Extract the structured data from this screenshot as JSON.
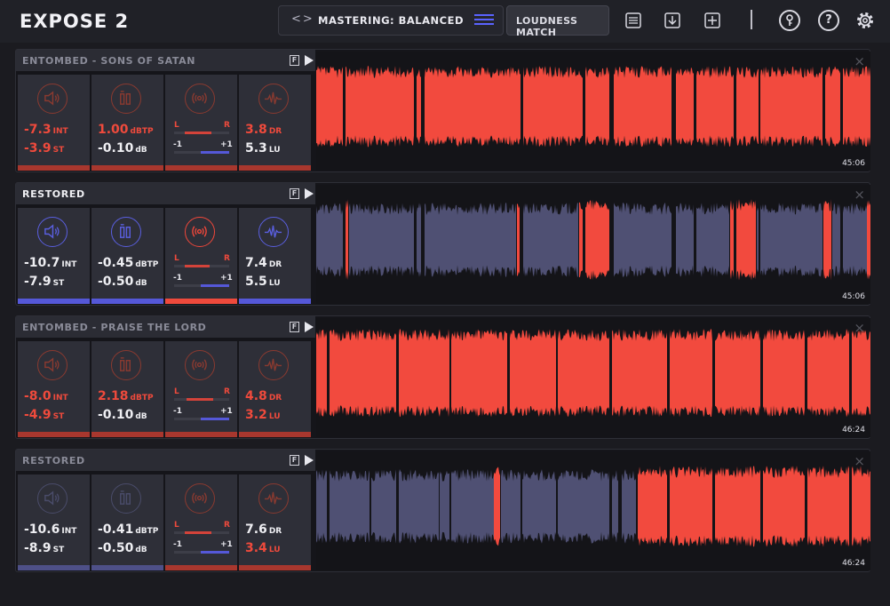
{
  "header": {
    "title": "EXPOSE 2",
    "preset_arrows": "<>",
    "preset_label": "MASTERING: BALANCED",
    "loudness_match_label": "LOUDNESS MATCH"
  },
  "rows": [
    {
      "title": "ENTOMBED - SONS OF SATAN",
      "active": false,
      "f_label": "F",
      "loudness": {
        "int": "-7.3",
        "int_unit": "INT",
        "st": "-3.9",
        "st_unit": "ST"
      },
      "peak": {
        "tp": "1.00",
        "tp_unit": "dBTP",
        "db": "-0.10",
        "db_unit": "dB"
      },
      "correlation": {
        "left": "L",
        "right": "R",
        "min": "-1",
        "max": "+1"
      },
      "dynamics": {
        "dr": "3.8",
        "dr_unit": "DR",
        "lu": "5.3",
        "lu_unit": "LU"
      },
      "duration": "45:06",
      "close": "×"
    },
    {
      "title": "RESTORED",
      "active": true,
      "f_label": "F",
      "loudness": {
        "int": "-10.7",
        "int_unit": "INT",
        "st": "-7.9",
        "st_unit": "ST"
      },
      "peak": {
        "tp": "-0.45",
        "tp_unit": "dBTP",
        "db": "-0.50",
        "db_unit": "dB"
      },
      "correlation": {
        "left": "L",
        "right": "R",
        "min": "-1",
        "max": "+1"
      },
      "dynamics": {
        "dr": "7.4",
        "dr_unit": "DR",
        "lu": "5.5",
        "lu_unit": "LU"
      },
      "duration": "45:06",
      "close": "×"
    },
    {
      "title": "ENTOMBED - PRAISE THE LORD",
      "active": false,
      "f_label": "F",
      "loudness": {
        "int": "-8.0",
        "int_unit": "INT",
        "st": "-4.9",
        "st_unit": "ST"
      },
      "peak": {
        "tp": "2.18",
        "tp_unit": "dBTP",
        "db": "-0.10",
        "db_unit": "dB"
      },
      "correlation": {
        "left": "L",
        "right": "R",
        "min": "-1",
        "max": "+1"
      },
      "dynamics": {
        "dr": "4.8",
        "dr_unit": "DR",
        "lu": "3.2",
        "lu_unit": "LU"
      },
      "duration": "46:24",
      "close": "×"
    },
    {
      "title": "RESTORED",
      "active": false,
      "f_label": "F",
      "loudness": {
        "int": "-10.6",
        "int_unit": "INT",
        "st": "-8.9",
        "st_unit": "ST"
      },
      "peak": {
        "tp": "-0.41",
        "tp_unit": "dBTP",
        "db": "-0.50",
        "db_unit": "dB"
      },
      "correlation": {
        "left": "L",
        "right": "R",
        "min": "-1",
        "max": "+1"
      },
      "dynamics": {
        "dr": "7.6",
        "dr_unit": "DR",
        "lu": "3.4",
        "lu_unit": "LU"
      },
      "duration": "46:24",
      "close": "×"
    }
  ],
  "colors": {
    "accent_red": "#ef4a3c",
    "accent_blue": "#5558d8",
    "wave_red": "#f24a3e",
    "wave_blue": "#4f5073",
    "background": "#1b1b20"
  }
}
